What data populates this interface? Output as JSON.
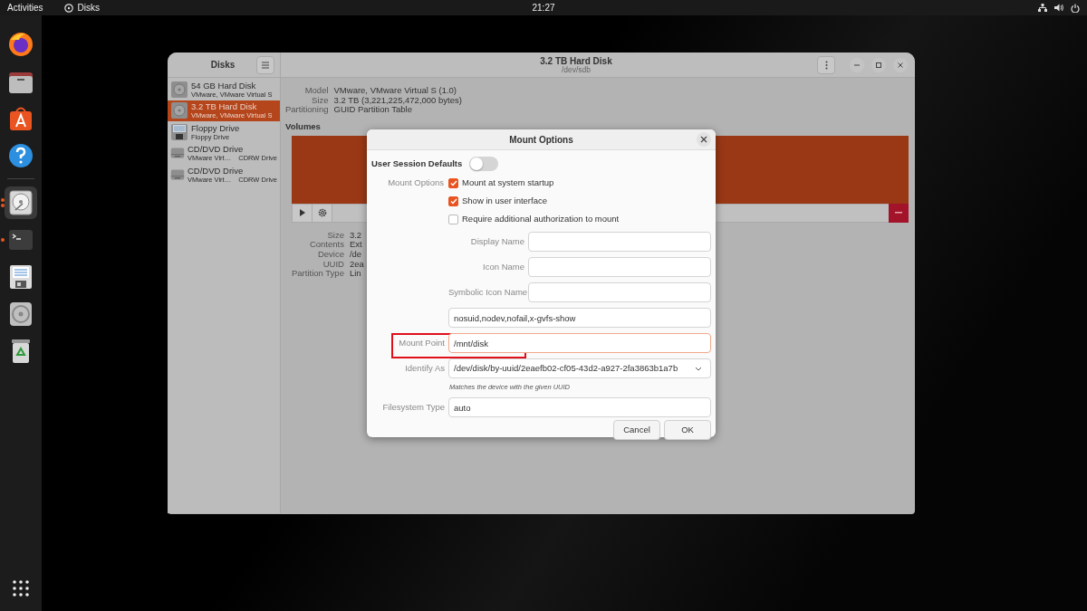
{
  "top_bar": {
    "activities": "Activities",
    "app_name": "Disks",
    "clock": "21:27"
  },
  "dock": [
    {
      "kind": "firefox",
      "running": false,
      "focused": false,
      "many_windows": false
    },
    {
      "kind": "files",
      "running": false,
      "focused": false,
      "many_windows": false
    },
    {
      "kind": "software",
      "running": false,
      "focused": false,
      "many_windows": false
    },
    {
      "kind": "help",
      "running": false,
      "focused": false,
      "many_windows": false
    },
    {
      "kind": "disks",
      "running": true,
      "focused": true,
      "many_windows": true
    },
    {
      "kind": "terminal",
      "running": true,
      "focused": false,
      "many_windows": false
    },
    {
      "kind": "editor",
      "running": false,
      "focused": false,
      "many_windows": false
    },
    {
      "kind": "optical",
      "running": false,
      "focused": false,
      "many_windows": false
    },
    {
      "kind": "trash",
      "running": false,
      "focused": false,
      "many_windows": false
    }
  ],
  "disks_window": {
    "sidebar_title": "Disks",
    "title": "3.2 TB Hard Disk",
    "subtitle": "/dev/sdb",
    "drives": [
      {
        "kind": "hdd",
        "name": "54 GB Hard Disk",
        "detail": "VMware, VMware Virtual S",
        "selected": false
      },
      {
        "kind": "hdd",
        "name": "3.2 TB Hard Disk",
        "detail": "VMware, VMware Virtual S",
        "selected": true
      },
      {
        "kind": "floppy",
        "name": "Floppy Drive",
        "detail": "Floppy Drive",
        "selected": false
      },
      {
        "kind": "optical",
        "name": "CD/DVD Drive",
        "detail": "VMware Virt…",
        "detail_2": "CDRW Drive",
        "selected": false
      },
      {
        "kind": "optical",
        "name": "CD/DVD Drive",
        "detail": "VMware Virt…",
        "detail_2": "CDRW Drive",
        "selected": false
      }
    ],
    "drive_info": [
      {
        "label": "Model",
        "value": "VMware, VMware Virtual S (1.0)"
      },
      {
        "label": "Size",
        "value": "3.2 TB (3,221,225,472,000 bytes)"
      },
      {
        "label": "Partitioning",
        "value": "GUID Partition Table"
      }
    ],
    "volumes_heading": "Volumes",
    "partition_info": [
      {
        "label": "Size",
        "value": "3.2"
      },
      {
        "label": "Contents",
        "value": "Ext"
      },
      {
        "label": "Device",
        "value": "/de"
      },
      {
        "label": "UUID",
        "value": "2ea"
      },
      {
        "label": "Partition Type",
        "value": "Lin"
      }
    ]
  },
  "dialog": {
    "title": "Mount Options",
    "session_defaults": {
      "label": "User Session Defaults",
      "on": false
    },
    "options_label": "Mount Options",
    "checkboxes": [
      {
        "label": "Mount at system startup",
        "checked": true
      },
      {
        "label": "Show in user interface",
        "checked": true
      },
      {
        "label": "Require additional authorization to mount",
        "checked": false
      }
    ],
    "name_fields": [
      {
        "label": "Display Name"
      },
      {
        "label": "Icon Name"
      },
      {
        "label": "Symbolic Icon Name"
      }
    ],
    "fields": [
      {
        "kind": "text",
        "value": "nosuid,nodev,nofail,x-gvfs-show",
        "focused": false,
        "highlighted": false
      },
      {
        "kind": "text",
        "label": "Mount Point",
        "value": "/mnt/disk",
        "focused": true,
        "highlighted": true
      },
      {
        "kind": "dropdown",
        "label": "Identify As",
        "value": "/dev/disk/by-uuid/2eaefb02-cf05-43d2-a927-2fa3863b1a7b",
        "hint": "Matches the device with the given UUID",
        "focused": false,
        "highlighted": false
      },
      {
        "kind": "text",
        "label": "Filesystem Type",
        "value": "auto",
        "focused": false,
        "highlighted": false
      }
    ],
    "buttons": [
      "Cancel",
      "OK"
    ]
  }
}
